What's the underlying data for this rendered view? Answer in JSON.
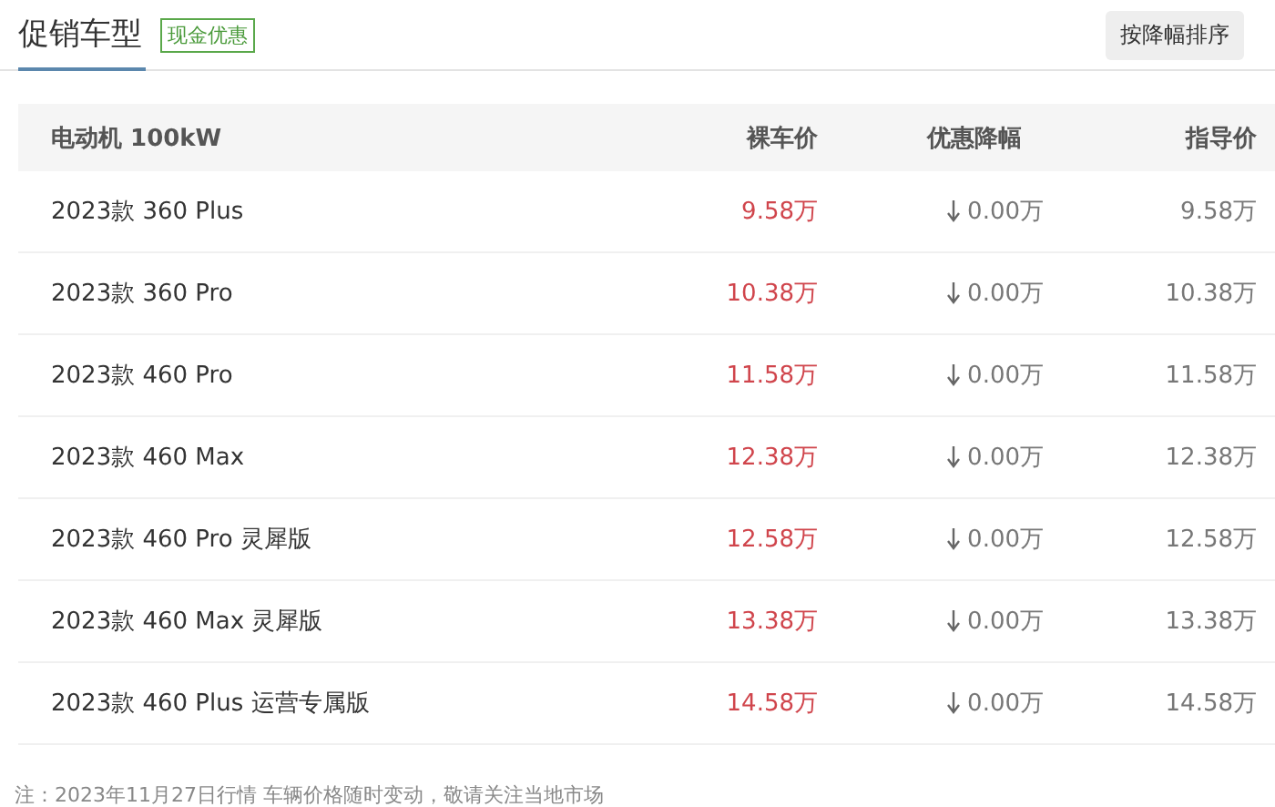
{
  "tabs": [
    {
      "label": "促销车型",
      "selected": true
    }
  ],
  "badge": "现金优惠",
  "sort_button": "按降幅排序",
  "table": {
    "columns": [
      "电动机 100kW",
      "裸车价",
      "优惠降幅",
      "指导价"
    ],
    "rows": [
      {
        "name": "2023款 360 Plus",
        "price": "9.58万",
        "discount": "0.00万",
        "guide": "9.58万"
      },
      {
        "name": "2023款 360 Pro",
        "price": "10.38万",
        "discount": "0.00万",
        "guide": "10.38万"
      },
      {
        "name": "2023款 460 Pro",
        "price": "11.58万",
        "discount": "0.00万",
        "guide": "11.58万"
      },
      {
        "name": "2023款 460 Max",
        "price": "12.38万",
        "discount": "0.00万",
        "guide": "12.38万"
      },
      {
        "name": "2023款 460 Pro 灵犀版",
        "price": "12.58万",
        "discount": "0.00万",
        "guide": "12.58万"
      },
      {
        "name": "2023款 460 Max 灵犀版",
        "price": "13.38万",
        "discount": "0.00万",
        "guide": "13.38万"
      },
      {
        "name": "2023款 460 Plus 运营专属版",
        "price": "14.58万",
        "discount": "0.00万",
        "guide": "14.58万"
      }
    ]
  },
  "footnote": "注：2023年11月27日行情 车辆价格随时变动，敬请关注当地市场"
}
